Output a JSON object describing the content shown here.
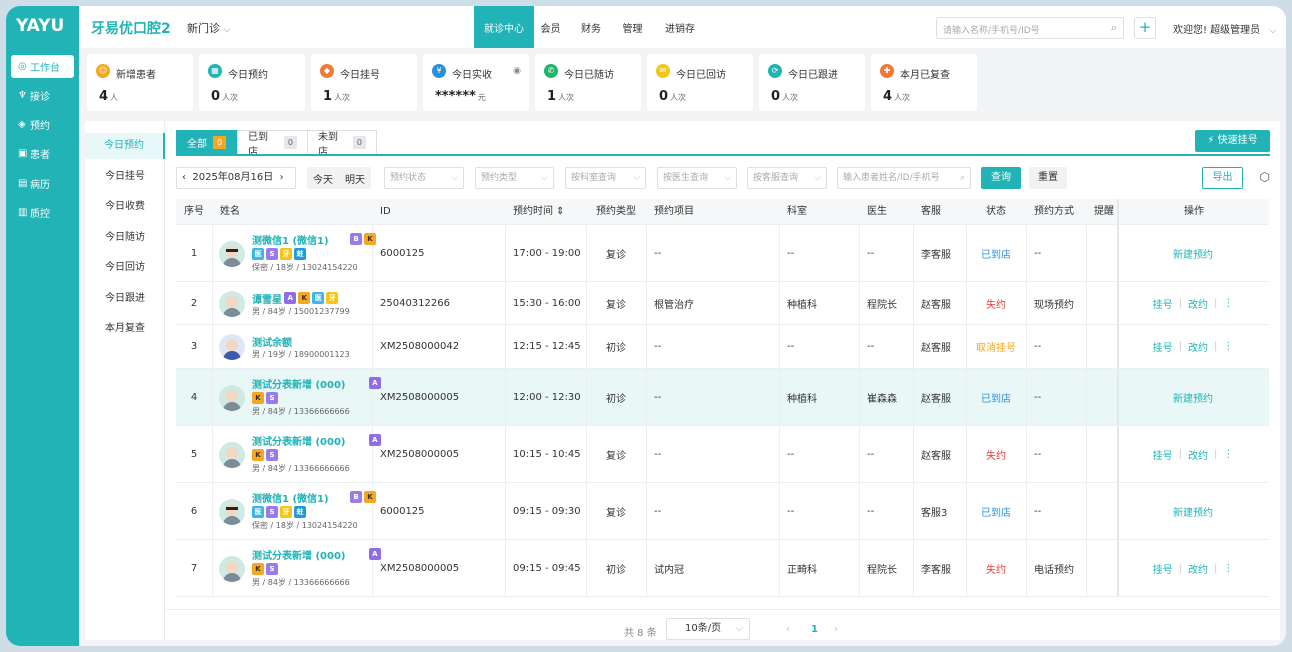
{
  "logo": "YAYU",
  "sidebar": [
    {
      "icon": "workbench-icon",
      "glyph": "◎",
      "label": "工作台",
      "active": true
    },
    {
      "icon": "reception-icon",
      "glyph": "♆",
      "label": "接诊",
      "active": false
    },
    {
      "icon": "appointment-icon",
      "glyph": "◈",
      "label": "预约",
      "active": false
    },
    {
      "icon": "patient-icon",
      "glyph": "▣",
      "label": "患者",
      "active": false
    },
    {
      "icon": "record-icon",
      "glyph": "▤",
      "label": "病历",
      "active": false
    },
    {
      "icon": "quality-icon",
      "glyph": "▥",
      "label": "质控",
      "active": false
    }
  ],
  "header": {
    "brand": "牙易优口腔2",
    "store": "新门诊",
    "nav": [
      "就诊中心",
      "会员",
      "财务",
      "管理",
      "进销存"
    ],
    "search_placeholder": "请输入名称/手机号/ID号",
    "welcome": "欢迎您!  超级管理员"
  },
  "stats": [
    {
      "label": "新增患者",
      "value": "4",
      "unit": "人",
      "color": "#f5a623",
      "icon": "user-icon",
      "glyph": "☺"
    },
    {
      "label": "今日预约",
      "value": "0",
      "unit": "人次",
      "color": "#21b3b6",
      "icon": "calendar-icon",
      "glyph": "▦"
    },
    {
      "label": "今日挂号",
      "value": "1",
      "unit": "人次",
      "color": "#f07a3a",
      "icon": "register-icon",
      "glyph": "◆"
    },
    {
      "label": "今日实收",
      "value": "******",
      "unit": "元",
      "color": "#2b8fd9",
      "icon": "payment-icon",
      "glyph": "¥"
    },
    {
      "label": "今日已随访",
      "value": "1",
      "unit": "人次",
      "color": "#23b36b",
      "icon": "phone-icon",
      "glyph": "✆"
    },
    {
      "label": "今日已回访",
      "value": "0",
      "unit": "人次",
      "color": "#f5c518",
      "icon": "message-icon",
      "glyph": "✉"
    },
    {
      "label": "今日已跟进",
      "value": "0",
      "unit": "人次",
      "color": "#21b3b6",
      "icon": "follow-icon",
      "glyph": "⟳"
    },
    {
      "label": "本月已复查",
      "value": "4",
      "unit": "人次",
      "color": "#f07a3a",
      "icon": "recheck-icon",
      "glyph": "✚"
    }
  ],
  "subnav": [
    "今日预约",
    "今日挂号",
    "今日收费",
    "今日随访",
    "今日回访",
    "今日跟进",
    "本月复查"
  ],
  "tabs": [
    {
      "label": "全部",
      "count": "0",
      "active": true
    },
    {
      "label": "已到店",
      "count": "0",
      "active": false
    },
    {
      "label": "未到店",
      "count": "0",
      "active": false
    }
  ],
  "quick_register": "快速挂号",
  "filters": {
    "date": "2025年08月16日",
    "today": "今天",
    "tomorrow": "明天",
    "status": "预约状态",
    "type": "预约类型",
    "dept": "按科室查询",
    "doctor": "按医生查询",
    "service": "按客服查询",
    "patient": "输入患者姓名/ID/手机号",
    "query": "查询",
    "reset": "重置",
    "export": "导出"
  },
  "columns": [
    "序号",
    "姓名",
    "ID",
    "预约时间",
    "预约类型",
    "预约项目",
    "科室",
    "医生",
    "客服",
    "状态",
    "预约方式",
    "提醒",
    "操作"
  ],
  "rows": [
    {
      "no": "1",
      "name": "测微信1 (微信1)",
      "info": "保密 / 18岁 / 13024154220",
      "tags1": [
        "B",
        "K"
      ],
      "tags2": [
        "医",
        "S",
        "牙",
        "蛀"
      ],
      "id": "6000125",
      "time": "17:00 - 19:00",
      "type": "复诊",
      "item": "--",
      "dept": "--",
      "doctor": "--",
      "cs": "李客服",
      "status": "已到店",
      "method": "--",
      "ops": [
        "新建预约"
      ],
      "avatar": "glasses",
      "hl": false
    },
    {
      "no": "2",
      "name": "谭雪星",
      "info": "男 / 84岁 / 15001237799",
      "tags1": [
        "A",
        "K",
        "医",
        "牙"
      ],
      "tags2": [],
      "id": "25040312266",
      "time": "15:30 - 16:00",
      "type": "复诊",
      "item": "根管治疗",
      "dept": "种植科",
      "doctor": "程院长",
      "cs": "赵客服",
      "status": "失约",
      "method": "现场预约",
      "ops": [
        "挂号",
        "改约",
        "⋮"
      ],
      "avatar": "old",
      "hl": false
    },
    {
      "no": "3",
      "name": "测试余额",
      "info": "男 / 19岁 / 18900001123",
      "tags1": [],
      "tags2": [],
      "id": "XM2508000042",
      "time": "12:15 - 12:45",
      "type": "初诊",
      "item": "--",
      "dept": "--",
      "doctor": "--",
      "cs": "赵客服",
      "status": "取消挂号",
      "method": "--",
      "ops": [
        "挂号",
        "改约",
        "⋮"
      ],
      "avatar": "young",
      "hl": false
    },
    {
      "no": "4",
      "name": "测试分表新增 (000)",
      "info": "男 / 84岁 / 13366666666",
      "tags1": [
        "A"
      ],
      "tags2": [
        "K",
        "S"
      ],
      "id": "XM2508000005",
      "time": "12:00 - 12:30",
      "type": "初诊",
      "item": "--",
      "dept": "种植科",
      "doctor": "崔森森",
      "cs": "赵客服",
      "status": "已到店",
      "method": "--",
      "ops": [
        "新建预约"
      ],
      "avatar": "old",
      "hl": true
    },
    {
      "no": "5",
      "name": "测试分表新增 (000)",
      "info": "男 / 84岁 / 13366666666",
      "tags1": [
        "A"
      ],
      "tags2": [
        "K",
        "S"
      ],
      "id": "XM2508000005",
      "time": "10:15 - 10:45",
      "type": "复诊",
      "item": "--",
      "dept": "--",
      "doctor": "--",
      "cs": "赵客服",
      "status": "失约",
      "method": "--",
      "ops": [
        "挂号",
        "改约",
        "⋮"
      ],
      "avatar": "old",
      "hl": false
    },
    {
      "no": "6",
      "name": "测微信1 (微信1)",
      "info": "保密 / 18岁 / 13024154220",
      "tags1": [
        "B",
        "K"
      ],
      "tags2": [
        "医",
        "S",
        "牙",
        "蛀"
      ],
      "id": "6000125",
      "time": "09:15 - 09:30",
      "type": "复诊",
      "item": "--",
      "dept": "--",
      "doctor": "--",
      "cs": "客服3",
      "status": "已到店",
      "method": "--",
      "ops": [
        "新建预约"
      ],
      "avatar": "glasses",
      "hl": false
    },
    {
      "no": "7",
      "name": "测试分表新增 (000)",
      "info": "男 / 84岁 / 13366666666",
      "tags1": [
        "A"
      ],
      "tags2": [
        "K",
        "S"
      ],
      "id": "XM2508000005",
      "time": "09:15 - 09:45",
      "type": "初诊",
      "item": "试内冠",
      "dept": "正畸科",
      "doctor": "程院长",
      "cs": "李客服",
      "status": "失约",
      "method": "电话预约",
      "ops": [
        "挂号",
        "改约",
        "⋮"
      ],
      "avatar": "old",
      "hl": false
    }
  ],
  "pager": {
    "total": "共 8 条",
    "size": "10条/页",
    "page": "1"
  }
}
